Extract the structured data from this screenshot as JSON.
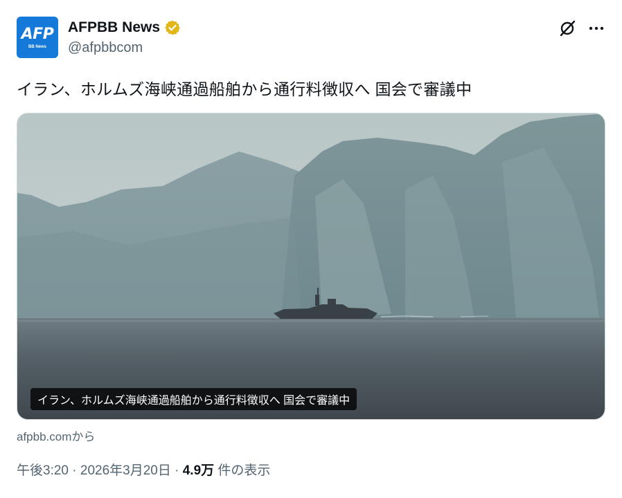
{
  "account": {
    "avatar_text": "AFP",
    "avatar_subtext": "BB News",
    "display_name": "AFPBB News",
    "handle": "@afpbbcom",
    "verified_color": "#e2b719",
    "brand_color": "#1479d8"
  },
  "actions": {
    "grok_icon": "grok-icon",
    "more_icon": "more-icon"
  },
  "tweet": {
    "text": "イラン、ホルムズ海峡通過船舶から通行料徴収へ 国会で審議中"
  },
  "media": {
    "caption": "イラン、ホルムズ海峡通過船舶から通行料徴収へ 国会で審議中"
  },
  "source": {
    "label": "afpbb.comから"
  },
  "meta": {
    "time": "午後3:20",
    "separator1": " · ",
    "date": "2026年3月20日",
    "separator2": " · ",
    "views": "4.9万",
    "views_label": " 件の表示"
  }
}
